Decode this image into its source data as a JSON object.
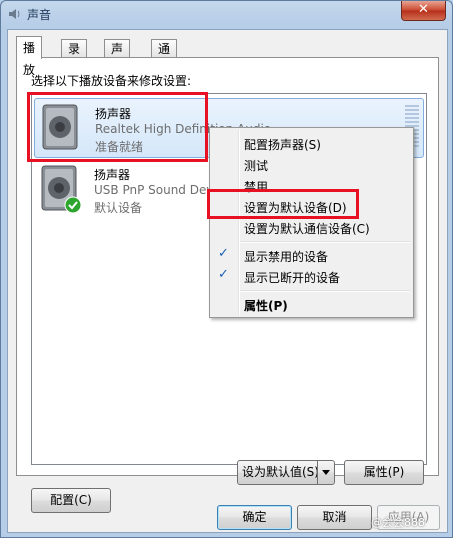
{
  "window": {
    "title": "声音",
    "close_label": "✕"
  },
  "tabs": [
    {
      "label": "播放"
    },
    {
      "label": "录制"
    },
    {
      "label": "声音"
    },
    {
      "label": "通信"
    }
  ],
  "instructions": "选择以下播放设备来修改设置:",
  "devices": [
    {
      "name": "扬声器",
      "description": "Realtek High Definition Audio",
      "status": "准备就绪",
      "selected": true,
      "default": false
    },
    {
      "name": "扬声器",
      "description": "USB PnP Sound Device",
      "status": "默认设备",
      "selected": false,
      "default": true
    }
  ],
  "context_menu": {
    "items": [
      {
        "label": "配置扬声器(S)"
      },
      {
        "label": "测试"
      },
      {
        "label": "禁用"
      },
      {
        "label": "设置为默认设备(D)"
      },
      {
        "label": "设置为默认通信设备(C)"
      },
      {
        "label": "显示禁用的设备",
        "checked": true
      },
      {
        "label": "显示已断开的设备",
        "checked": true
      },
      {
        "label": "属性(P)",
        "bold": true
      }
    ],
    "check_glyph": "✓"
  },
  "buttons": {
    "configure": "配置(C)",
    "set_default": "设为默认值(S)",
    "properties": "属性(P)",
    "ok": "确定",
    "cancel": "取消",
    "apply": "应用(A)"
  },
  "watermark": "@会会888",
  "colors": {
    "highlight": "#e81123",
    "selection": "#d4e7fa",
    "check": "#1a5fb4"
  }
}
